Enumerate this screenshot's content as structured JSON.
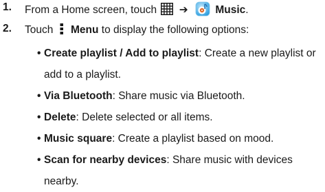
{
  "steps": [
    {
      "number": "1.",
      "parts": {
        "prefix": "From a Home screen, touch",
        "arrow": "➔",
        "app_label": "Music"
      }
    },
    {
      "number": "2.",
      "parts": {
        "prefix": "Touch",
        "menu_label": "Menu",
        "suffix": "to display the following options:"
      }
    }
  ],
  "options": [
    {
      "term": "Create playlist / Add to playlist",
      "desc": ": Create a new playlist or add to a playlist."
    },
    {
      "term": "Via Bluetooth",
      "desc": ": Share music via Bluetooth."
    },
    {
      "term": "Delete",
      "desc": ": Delete selected or all items."
    },
    {
      "term": "Music square",
      "desc": ": Create a playlist based on mood."
    },
    {
      "term": "Scan for nearby devices",
      "desc": ": Share music with devices nearby."
    }
  ],
  "icons": {
    "apps": "apps-grid-icon",
    "music": "music-app-icon",
    "menu": "menu-icon"
  },
  "colors": {
    "text": "#1a1a1a",
    "music_icon": "#3aa8e6"
  }
}
